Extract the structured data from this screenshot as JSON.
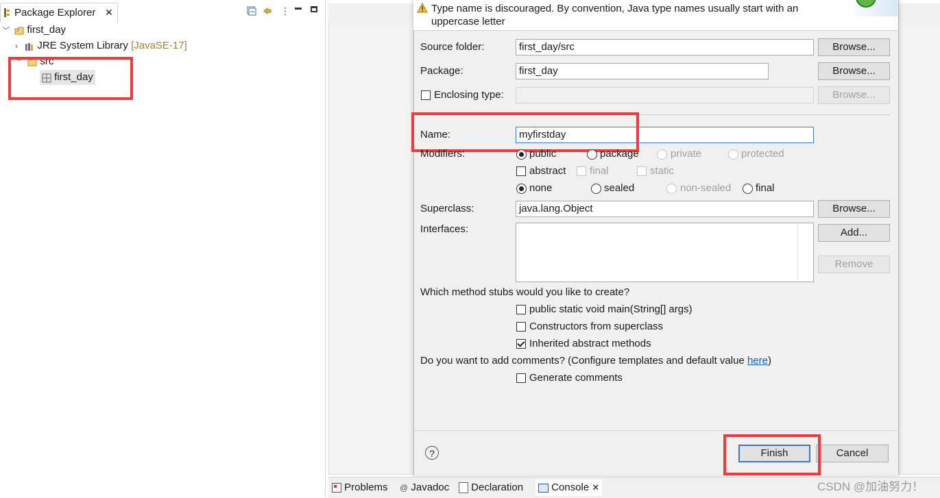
{
  "explorer": {
    "tab_label": "Package Explorer",
    "project": "first_day",
    "jre_label": "JRE System Library",
    "jre_version": "[JavaSE-17]",
    "src_label": "src",
    "package_label": "first_day"
  },
  "dialog": {
    "warning": "Type name is discouraged. By convention, Java type names usually start with an uppercase letter",
    "source_folder_label": "Source folder:",
    "source_folder_value": "first_day/src",
    "package_label": "Package:",
    "package_value": "first_day",
    "enclosing_label": "Enclosing type:",
    "browse": "Browse...",
    "name_label": "Name:",
    "name_value": "myfirstday",
    "modifiers_label": "Modifiers:",
    "mod_public": "public",
    "mod_package": "package",
    "mod_private": "private",
    "mod_protected": "protected",
    "mod_abstract": "abstract",
    "mod_final": "final",
    "mod_static": "static",
    "mod_none": "none",
    "mod_sealed": "sealed",
    "mod_nonsealed": "non-sealed",
    "mod_final2": "final",
    "superclass_label": "Superclass:",
    "superclass_value": "java.lang.Object",
    "interfaces_label": "Interfaces:",
    "add": "Add...",
    "remove": "Remove",
    "stubs_question": "Which method stubs would you like to create?",
    "stub_main": "public static void main(String[] args)",
    "stub_constructors": "Constructors from superclass",
    "stub_inherited": "Inherited abstract methods",
    "comments_question": "Do you want to add comments? (Configure templates and default value ",
    "comments_link": "here",
    "comments_close": ")",
    "generate_comments": "Generate comments",
    "finish": "Finish",
    "cancel": "Cancel"
  },
  "bottom_tabs": {
    "problems": "Problems",
    "javadoc": "Javadoc",
    "declaration": "Declaration",
    "console": "Console"
  },
  "watermark": "CSDN @加油努力！",
  "colors": {
    "highlight_box": "#ef3b3b",
    "link": "#1a5fb4",
    "default_button_border": "#3a76d6"
  }
}
